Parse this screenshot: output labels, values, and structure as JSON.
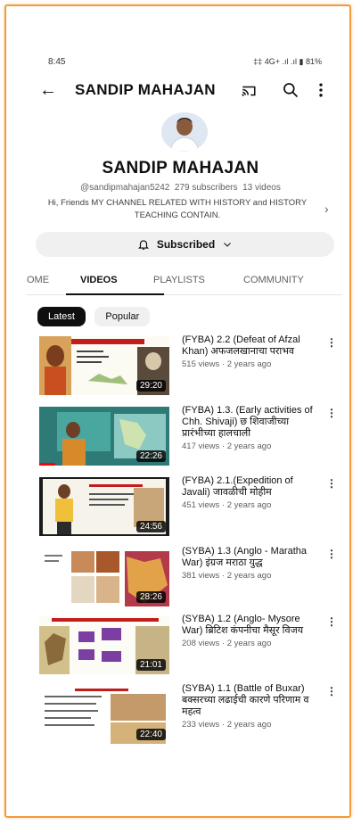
{
  "status_bar": {
    "time": "8:45",
    "indicators": "‡‡ 4G+ .ıl .ıl ▮ 81%"
  },
  "appbar": {
    "title": "SANDIP MAHAJAN"
  },
  "channel": {
    "name": "SANDIP MAHAJAN",
    "handle": "@sandipmahajan5242",
    "subscribers": "279 subscribers",
    "videos_count": "13 videos",
    "description": "Hi, Friends MY CHANNEL RELATED WITH HISTORY and HISTORY TEACHING CONTAIN."
  },
  "subscribe_button": {
    "label": "Subscribed"
  },
  "tabs": [
    {
      "label": "OME"
    },
    {
      "label": "VIDEOS"
    },
    {
      "label": "PLAYLISTS"
    },
    {
      "label": "COMMUNITY"
    }
  ],
  "chips": [
    {
      "label": "Latest"
    },
    {
      "label": "Popular"
    }
  ],
  "videos": [
    {
      "title": "(FYBA) 2.2 (Defeat of Afzal Khan) अफजलखानाचा पराभव",
      "views": "515 views",
      "age": "2 years ago",
      "duration": "29:20"
    },
    {
      "title": "(FYBA) 1.3. (Early activities of Chh. Shivaji) छ शिवाजीच्या प्रारंभीच्या हालचाली",
      "views": "417 views",
      "age": "2 years ago",
      "duration": "22:26"
    },
    {
      "title": "(FYBA) 2.1.(Expedition of Javali) जावळीची मोहीम",
      "views": "451 views",
      "age": "2 years ago",
      "duration": "24:56"
    },
    {
      "title": "(SYBA) 1.3 (Anglo - Maratha War) इंग्रज  मराठा युद्ध",
      "views": "381 views",
      "age": "2 years ago",
      "duration": "28:26"
    },
    {
      "title": "(SYBA) 1.2  (Anglo- Mysore War)  ब्रिटिश कंपनीचा मैसूर विजय",
      "views": "208 views",
      "age": "2 years ago",
      "duration": "21:01"
    },
    {
      "title": "(SYBA) 1.1  (Battle of Buxar)  बक्सरच्या लढाईची कारणे परिणाम व महत्व",
      "views": "233 views",
      "age": "2 years ago",
      "duration": "22:40"
    }
  ],
  "colors": {
    "accent_border": "#f39a3c",
    "chip_active": "#0f0f0f",
    "progress": "#ff0000"
  }
}
